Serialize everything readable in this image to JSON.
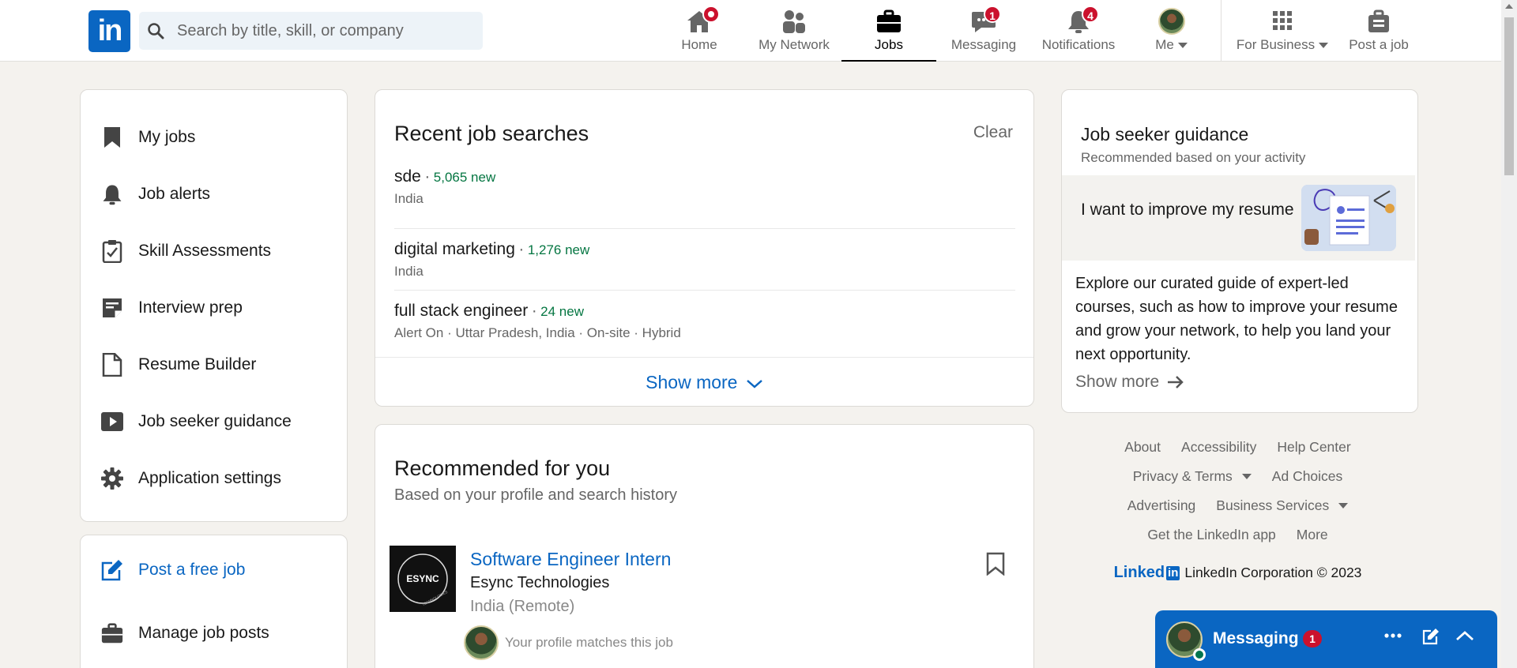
{
  "nav": {
    "logo_text": "in",
    "search_placeholder": "Search by title, skill, or company",
    "items": [
      {
        "label": "Home",
        "icon": "home-icon"
      },
      {
        "label": "My Network",
        "icon": "people-icon"
      },
      {
        "label": "Jobs",
        "icon": "briefcase-icon"
      },
      {
        "label": "Messaging",
        "icon": "chat-icon",
        "badge": "1"
      },
      {
        "label": "Notifications",
        "icon": "bell-icon",
        "badge": "4"
      },
      {
        "label": "Me",
        "icon": "avatar"
      },
      {
        "label": "For Business",
        "icon": "grid-icon"
      },
      {
        "label": "Post a job",
        "icon": "briefcase-post-icon"
      }
    ]
  },
  "sidebar": {
    "items": [
      {
        "label": "My jobs",
        "icon": "bookmark-icon"
      },
      {
        "label": "Job alerts",
        "icon": "bell-icon"
      },
      {
        "label": "Skill Assessments",
        "icon": "clipboard-check-icon"
      },
      {
        "label": "Interview prep",
        "icon": "note-icon"
      },
      {
        "label": "Resume Builder",
        "icon": "document-icon"
      },
      {
        "label": "Job seeker guidance",
        "icon": "video-icon"
      },
      {
        "label": "Application settings",
        "icon": "gear-icon"
      }
    ],
    "secondary": [
      {
        "label": "Post a free job",
        "icon": "edit-icon"
      },
      {
        "label": "Manage job posts",
        "icon": "briefcase-icon"
      }
    ]
  },
  "recent_searches": {
    "title": "Recent job searches",
    "clear_label": "Clear",
    "items": [
      {
        "query": "sde",
        "new": "5,065 new",
        "details": "India"
      },
      {
        "query": "digital marketing",
        "new": "1,276 new",
        "details": "India"
      },
      {
        "query": "full stack engineer",
        "new": "24 new",
        "details": "Alert On · Uttar Pradesh, India · On-site · Hybrid"
      }
    ],
    "show_more_label": "Show more"
  },
  "recommended": {
    "title": "Recommended for you",
    "subtitle": "Based on your profile and search history",
    "jobs": [
      {
        "title": "Software Engineer Intern",
        "company": "Esync Technologies",
        "location": "India (Remote)",
        "logo_text": "ESYNC",
        "logo_subtext": "TECHNOLOGIES",
        "match_text": "Your profile matches this job"
      }
    ]
  },
  "guidance": {
    "title": "Job seeker guidance",
    "subtitle": "Recommended based on your activity",
    "banner_text": "I want to improve my resume",
    "body": "Explore our curated guide of expert-led courses, such as how to improve your resume and grow your network, to help you land your next opportunity.",
    "show_more_label": "Show more"
  },
  "footer": {
    "row1": [
      "About",
      "Accessibility",
      "Help Center"
    ],
    "row2": [
      "Privacy & Terms",
      "Ad Choices"
    ],
    "row3": [
      "Advertising",
      "Business Services"
    ],
    "row4": [
      "Get the LinkedIn app",
      "More"
    ],
    "brand_word": "Linked",
    "brand_box": "in",
    "copyright": "LinkedIn Corporation © 2023"
  },
  "messaging_popup": {
    "title": "Messaging",
    "badge": "1"
  },
  "colors": {
    "brand_blue": "#0a66c2",
    "new_green": "#057642",
    "badge_red": "#cb112d",
    "page_bg": "#f4f2ee"
  }
}
